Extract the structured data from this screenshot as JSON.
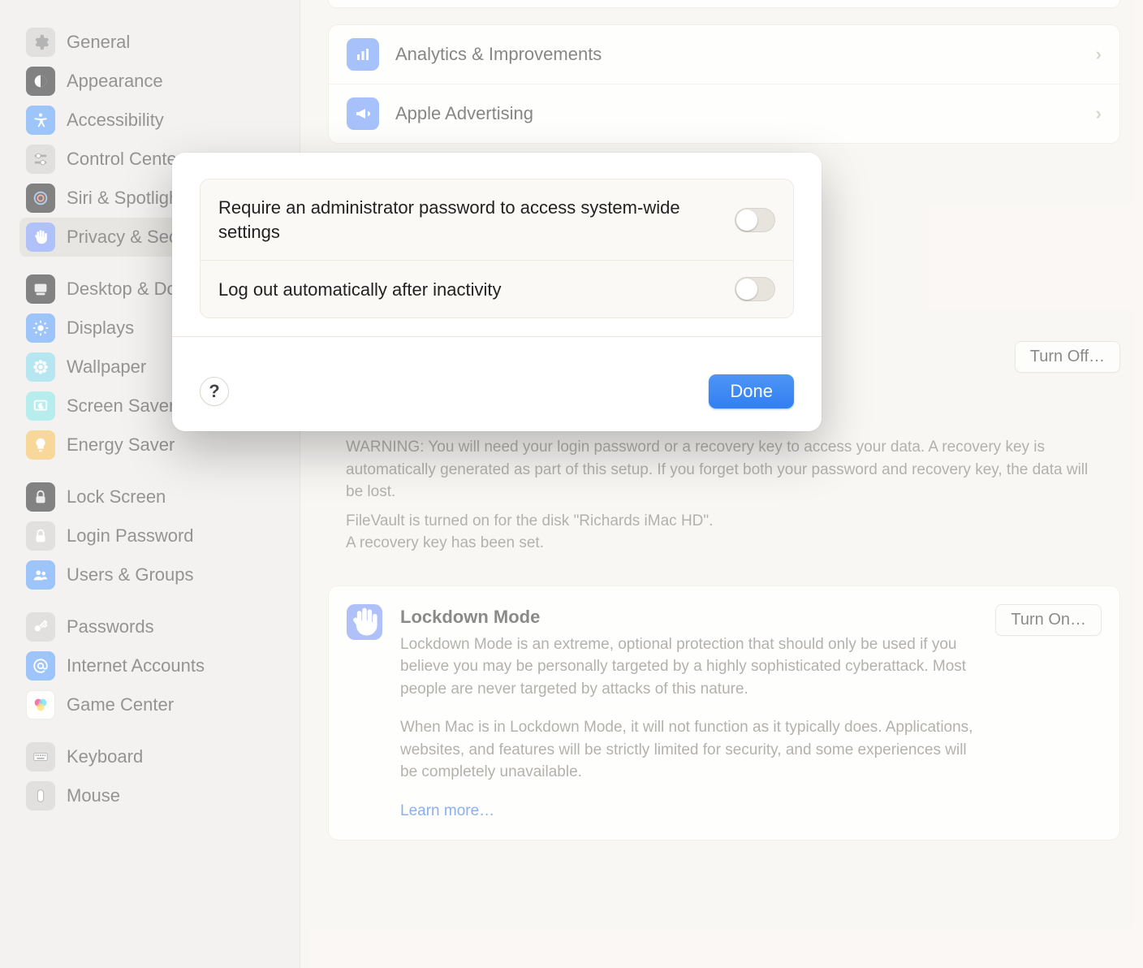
{
  "sidebar": {
    "groups": [
      {
        "items": [
          {
            "id": "general",
            "label": "General"
          },
          {
            "id": "appearance",
            "label": "Appearance"
          },
          {
            "id": "accessibility",
            "label": "Accessibility"
          },
          {
            "id": "control-center",
            "label": "Control Center"
          },
          {
            "id": "siri-spotlight",
            "label": "Siri & Spotlight"
          },
          {
            "id": "privacy-security",
            "label": "Privacy & Security",
            "selected": true
          }
        ]
      },
      {
        "items": [
          {
            "id": "desktop-dock",
            "label": "Desktop & Dock"
          },
          {
            "id": "displays",
            "label": "Displays"
          },
          {
            "id": "wallpaper",
            "label": "Wallpaper"
          },
          {
            "id": "screen-saver",
            "label": "Screen Saver"
          },
          {
            "id": "energy-saver",
            "label": "Energy Saver"
          }
        ]
      },
      {
        "items": [
          {
            "id": "lock-screen",
            "label": "Lock Screen"
          },
          {
            "id": "login-password",
            "label": "Login Password"
          },
          {
            "id": "users-groups",
            "label": "Users & Groups"
          }
        ]
      },
      {
        "items": [
          {
            "id": "passwords",
            "label": "Passwords"
          },
          {
            "id": "internet-accounts",
            "label": "Internet Accounts"
          },
          {
            "id": "game-center",
            "label": "Game Center"
          }
        ]
      },
      {
        "items": [
          {
            "id": "keyboard",
            "label": "Keyboard"
          },
          {
            "id": "mouse",
            "label": "Mouse"
          }
        ]
      }
    ]
  },
  "main": {
    "rows": [
      {
        "id": "analytics",
        "label": "Analytics & Improvements"
      },
      {
        "id": "advertising",
        "label": "Apple Advertising"
      }
    ],
    "filevault": {
      "turn_off_label": "Turn Off…",
      "warning": "WARNING: You will need your login password or a recovery key to access your data. A recovery key is automatically generated as part of this setup. If you forget both your password and recovery key, the data will be lost.",
      "status_line1": "FileVault is turned on for the disk \"Richards iMac HD\".",
      "status_line2": "A recovery key has been set."
    },
    "lockdown": {
      "title": "Lockdown Mode",
      "turn_on_label": "Turn On…",
      "p1": "Lockdown Mode is an extreme, optional protection that should only be used if you believe you may be personally targeted by a highly sophisticated cyberattack. Most people are never targeted by attacks of this nature.",
      "p2": "When Mac is in Lockdown Mode, it will not function as it typically does. Applications, websites, and features will be strictly limited for security, and some experiences will be completely unavailable.",
      "learn_more": "Learn more…"
    }
  },
  "modal": {
    "rows": [
      {
        "id": "admin-password",
        "label": "Require an administrator password to access system-wide settings",
        "on": false
      },
      {
        "id": "auto-logout",
        "label": "Log out automatically after inactivity",
        "on": false
      }
    ],
    "help_label": "?",
    "done_label": "Done"
  }
}
